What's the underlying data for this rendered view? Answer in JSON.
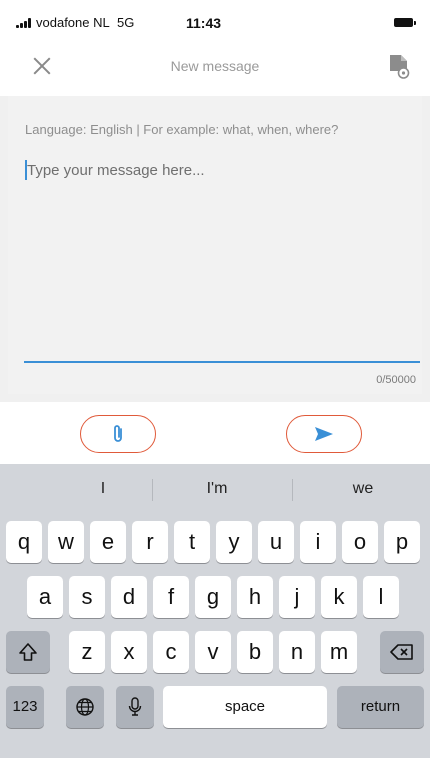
{
  "status_bar": {
    "carrier": "vodafone NL",
    "network": "5G",
    "time": "11:43"
  },
  "header": {
    "title": "New message",
    "close_icon": "close-icon",
    "document_icon": "document-settings-icon"
  },
  "compose": {
    "hint": "Language: English | For example: what, when, where?",
    "placeholder": "Type your message here...",
    "counter": "0/50000"
  },
  "actions": {
    "attach_icon": "paperclip-icon",
    "send_icon": "send-icon",
    "accent_color": "#e05a3a",
    "send_color": "#3a8fd6"
  },
  "keyboard": {
    "suggestions": [
      "I",
      "I'm",
      "we"
    ],
    "row1": [
      "q",
      "w",
      "e",
      "r",
      "t",
      "y",
      "u",
      "i",
      "o",
      "p"
    ],
    "row2": [
      "a",
      "s",
      "d",
      "f",
      "g",
      "h",
      "j",
      "k",
      "l"
    ],
    "row3": [
      "z",
      "x",
      "c",
      "v",
      "b",
      "n",
      "m"
    ],
    "numbers_label": "123",
    "space_label": "space",
    "return_label": "return"
  }
}
